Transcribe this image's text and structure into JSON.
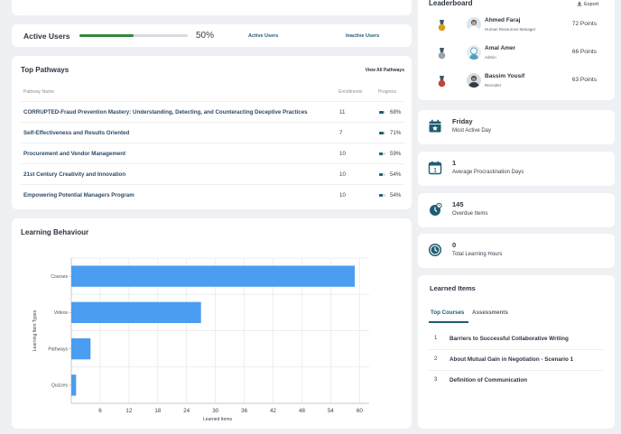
{
  "active_users": {
    "label": "Active Users",
    "fraction": 0.5,
    "percent_text": "50%",
    "active_link": "Active Users",
    "inactive_link": "Inactive Users"
  },
  "pathways": {
    "title": "Top Pathways",
    "view_all": "View All Pathways",
    "columns": [
      "Pathway Name",
      "Enrollments",
      "Progress"
    ],
    "rows": [
      {
        "name": "CORRUPTED-Fraud Prevention Mastery: Understanding, Detecting, and Counteracting Deceptive Practices",
        "enrollments": "11",
        "progress": "68%",
        "fraction": 0.68
      },
      {
        "name": "Self-Effectiveness and Results Oriented",
        "enrollments": "7",
        "progress": "71%",
        "fraction": 0.71
      },
      {
        "name": "Procurement and Vendor Management",
        "enrollments": "10",
        "progress": "59%",
        "fraction": 0.59
      },
      {
        "name": "21st Century Creativity and Innovation",
        "enrollments": "10",
        "progress": "54%",
        "fraction": 0.54
      },
      {
        "name": "Empowering Potential Managers Program",
        "enrollments": "10",
        "progress": "54%",
        "fraction": 0.54
      }
    ]
  },
  "behaviour": {
    "title": "Learning Behaviour"
  },
  "chart_data": {
    "type": "bar",
    "orientation": "horizontal",
    "categories": [
      "Courses",
      "Videos",
      "Pathways",
      "Quizzes"
    ],
    "values": [
      59,
      27,
      4,
      1
    ],
    "xticks": [
      6,
      12,
      18,
      24,
      30,
      36,
      42,
      48,
      54,
      60
    ],
    "xlim": [
      0,
      62
    ],
    "xlabel": "Learned Items",
    "ylabel": "Learning Item Types",
    "grid": true,
    "bar_color": "#4a9df0"
  },
  "leaderboard": {
    "title": "Leaderboard",
    "export": "Export",
    "entries": [
      {
        "name": "Ahmed Faraj",
        "role": "Human Resources Manager",
        "points": "72 Points",
        "medal_color": "#d4a017"
      },
      {
        "name": "Amal Amer",
        "role": "Admin",
        "points": "66 Points",
        "medal_color": "#9aa1a8"
      },
      {
        "name": "Bassim Yousif",
        "role": "Recruiter",
        "points": "63 Points",
        "medal_color": "#c0453a"
      }
    ]
  },
  "stats": [
    {
      "value": "Friday",
      "caption": "Most Active Day",
      "icon": "calendar-star-icon"
    },
    {
      "value": "1",
      "caption": "Average Procrastination Days",
      "icon": "calendar-one-icon"
    },
    {
      "value": "145",
      "caption": "Overdue Items",
      "icon": "overdue-clock-icon"
    },
    {
      "value": "0",
      "caption": "Total Learning Hours",
      "icon": "clock-icon"
    }
  ],
  "learned_items": {
    "title": "Learned Items",
    "tabs": [
      "Top Courses",
      "Assessments"
    ],
    "items": [
      {
        "num": "1",
        "name": "Barriers to Successful Collaborative Writing"
      },
      {
        "num": "2",
        "name": "About Mutual Gain in Negotiation - Scenario 1"
      },
      {
        "num": "3",
        "name": "Definition of Communication"
      }
    ]
  },
  "colors": {
    "accent": "#1f5c73",
    "progress_green": "#2d8a3a",
    "bar_blue": "#4a9df0"
  }
}
